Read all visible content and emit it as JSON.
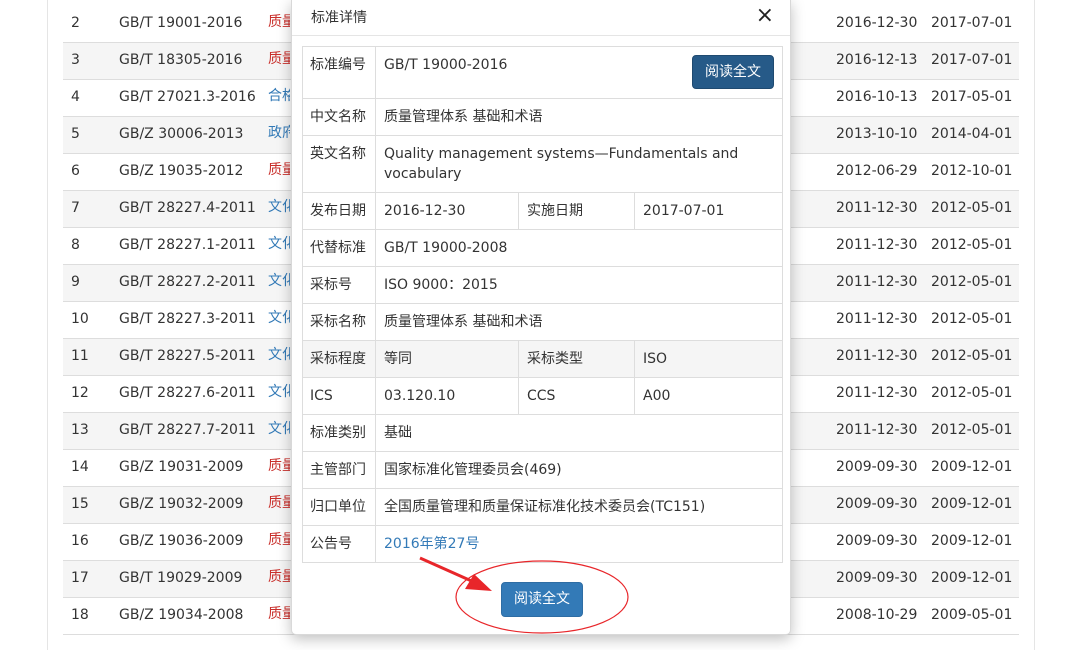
{
  "background_rows": [
    {
      "no": "2",
      "code": "GB/T 19001-2016",
      "name": "质量",
      "color": "red",
      "pub": "2016-12-30",
      "impl": "2017-07-01"
    },
    {
      "no": "3",
      "code": "GB/T 18305-2016",
      "name": "质量",
      "color": "red",
      "pub": "2016-12-13",
      "impl": "2017-07-01"
    },
    {
      "no": "4",
      "code": "GB/T 27021.3-2016",
      "name": "合格",
      "color": "blue",
      "pub": "2016-10-13",
      "impl": "2017-05-01"
    },
    {
      "no": "5",
      "code": "GB/Z 30006-2013",
      "name": "政府",
      "color": "blue",
      "pub": "2013-10-10",
      "impl": "2014-04-01"
    },
    {
      "no": "6",
      "code": "GB/Z 19035-2012",
      "name": "质量",
      "color": "red",
      "pub": "2012-06-29",
      "impl": "2012-10-01"
    },
    {
      "no": "7",
      "code": "GB/T 28227.4-2011",
      "name": "文化",
      "color": "blue",
      "pub": "2011-12-30",
      "impl": "2012-05-01"
    },
    {
      "no": "8",
      "code": "GB/T 28227.1-2011",
      "name": "文化",
      "color": "blue",
      "pub": "2011-12-30",
      "impl": "2012-05-01"
    },
    {
      "no": "9",
      "code": "GB/T 28227.2-2011",
      "name": "文化",
      "color": "blue",
      "pub": "2011-12-30",
      "impl": "2012-05-01"
    },
    {
      "no": "10",
      "code": "GB/T 28227.3-2011",
      "name": "文化",
      "color": "blue",
      "pub": "2011-12-30",
      "impl": "2012-05-01"
    },
    {
      "no": "11",
      "code": "GB/T 28227.5-2011",
      "name": "文化",
      "color": "blue",
      "pub": "2011-12-30",
      "impl": "2012-05-01"
    },
    {
      "no": "12",
      "code": "GB/T 28227.6-2011",
      "name": "文化",
      "color": "blue",
      "pub": "2011-12-30",
      "impl": "2012-05-01"
    },
    {
      "no": "13",
      "code": "GB/T 28227.7-2011",
      "name": "文化",
      "color": "blue",
      "pub": "2011-12-30",
      "impl": "2012-05-01"
    },
    {
      "no": "14",
      "code": "GB/Z 19031-2009",
      "name": "质量",
      "color": "red",
      "pub": "2009-09-30",
      "impl": "2009-12-01"
    },
    {
      "no": "15",
      "code": "GB/Z 19032-2009",
      "name": "质量",
      "color": "red",
      "pub": "2009-09-30",
      "impl": "2009-12-01"
    },
    {
      "no": "16",
      "code": "GB/Z 19036-2009",
      "name": "质量",
      "color": "red",
      "pub": "2009-09-30",
      "impl": "2009-12-01"
    },
    {
      "no": "17",
      "code": "GB/T 19029-2009",
      "name": "质量",
      "color": "red",
      "pub": "2009-09-30",
      "impl": "2009-12-01"
    },
    {
      "no": "18",
      "code": "GB/Z 19034-2008",
      "name": "质量",
      "color": "red",
      "pub": "2008-10-29",
      "impl": "2009-05-01"
    }
  ],
  "modal": {
    "title": "标准详情",
    "close_glyph": "×",
    "read_full_label": "阅读全文",
    "fields": {
      "std_no_label": "标准编号",
      "std_no": "GB/T 19000-2016",
      "cn_name_label": "中文名称",
      "cn_name": "质量管理体系 基础和术语",
      "en_name_label": "英文名称",
      "en_name": "Quality management systems—Fundamentals and vocabulary",
      "pub_date_label": "发布日期",
      "pub_date": "2016-12-30",
      "impl_date_label": "实施日期",
      "impl_date": "2017-07-01",
      "replaces_label": "代替标准",
      "replaces": "GB/T 19000-2008",
      "adopted_no_label": "采标号",
      "adopted_no": "ISO 9000：2015",
      "adopted_name_label": "采标名称",
      "adopted_name": "质量管理体系 基础和术语",
      "adopt_degree_label": "采标程度",
      "adopt_degree": "等同",
      "adopt_type_label": "采标类型",
      "adopt_type": "ISO",
      "ics_label": "ICS",
      "ics": "03.120.10",
      "ccs_label": "CCS",
      "ccs": "A00",
      "category_label": "标准类别",
      "category": "基础",
      "dept_label": "主管部门",
      "dept": "国家标准化管理委员会(469)",
      "owner_label": "归口单位",
      "owner": "全国质量管理和质量保证标准化技术委员会(TC151)",
      "notice_label": "公告号",
      "notice": "2016年第27号"
    }
  },
  "colors": {
    "primary": "#337ab7",
    "annotation_red": "#e8262a",
    "red_text": "#c9302c"
  }
}
